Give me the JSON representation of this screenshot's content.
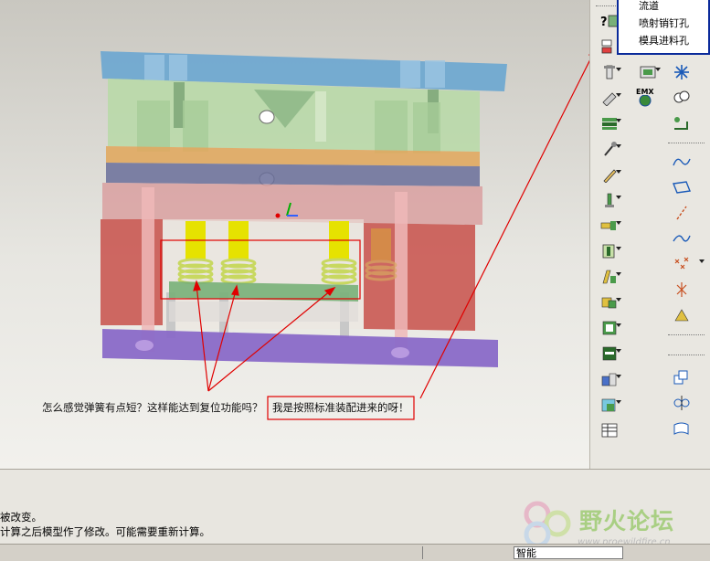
{
  "viewport": {
    "annotation_question": "怎么感觉弹簧有点短？这样能达到复位功能吗？",
    "annotation_answer": "我是按照标准装配进来的呀！"
  },
  "popup_menu": {
    "items": [
      "流道",
      "喷射销钉孔",
      "模具进料孔"
    ]
  },
  "toolbar": {
    "emx_label": "EMX"
  },
  "message_area": {
    "lines": [
      "被改变。",
      "计算之后模型作了修改。可能需要重新计算。"
    ]
  },
  "status_bar": {
    "filter_value": "智能"
  },
  "watermark": {
    "title": "野火论坛",
    "url": "www.proewildfire.cn"
  },
  "colors": {
    "top_plate": "#6aa6d0",
    "a_plate": "#b9d9a8",
    "b_plate": "#d9a0a0",
    "support": "#c8504a",
    "ejector_plate": "#78b078",
    "bottom_plate": "#8a6ac8",
    "spring": "#d8de60",
    "annotation_red": "#e00000"
  }
}
